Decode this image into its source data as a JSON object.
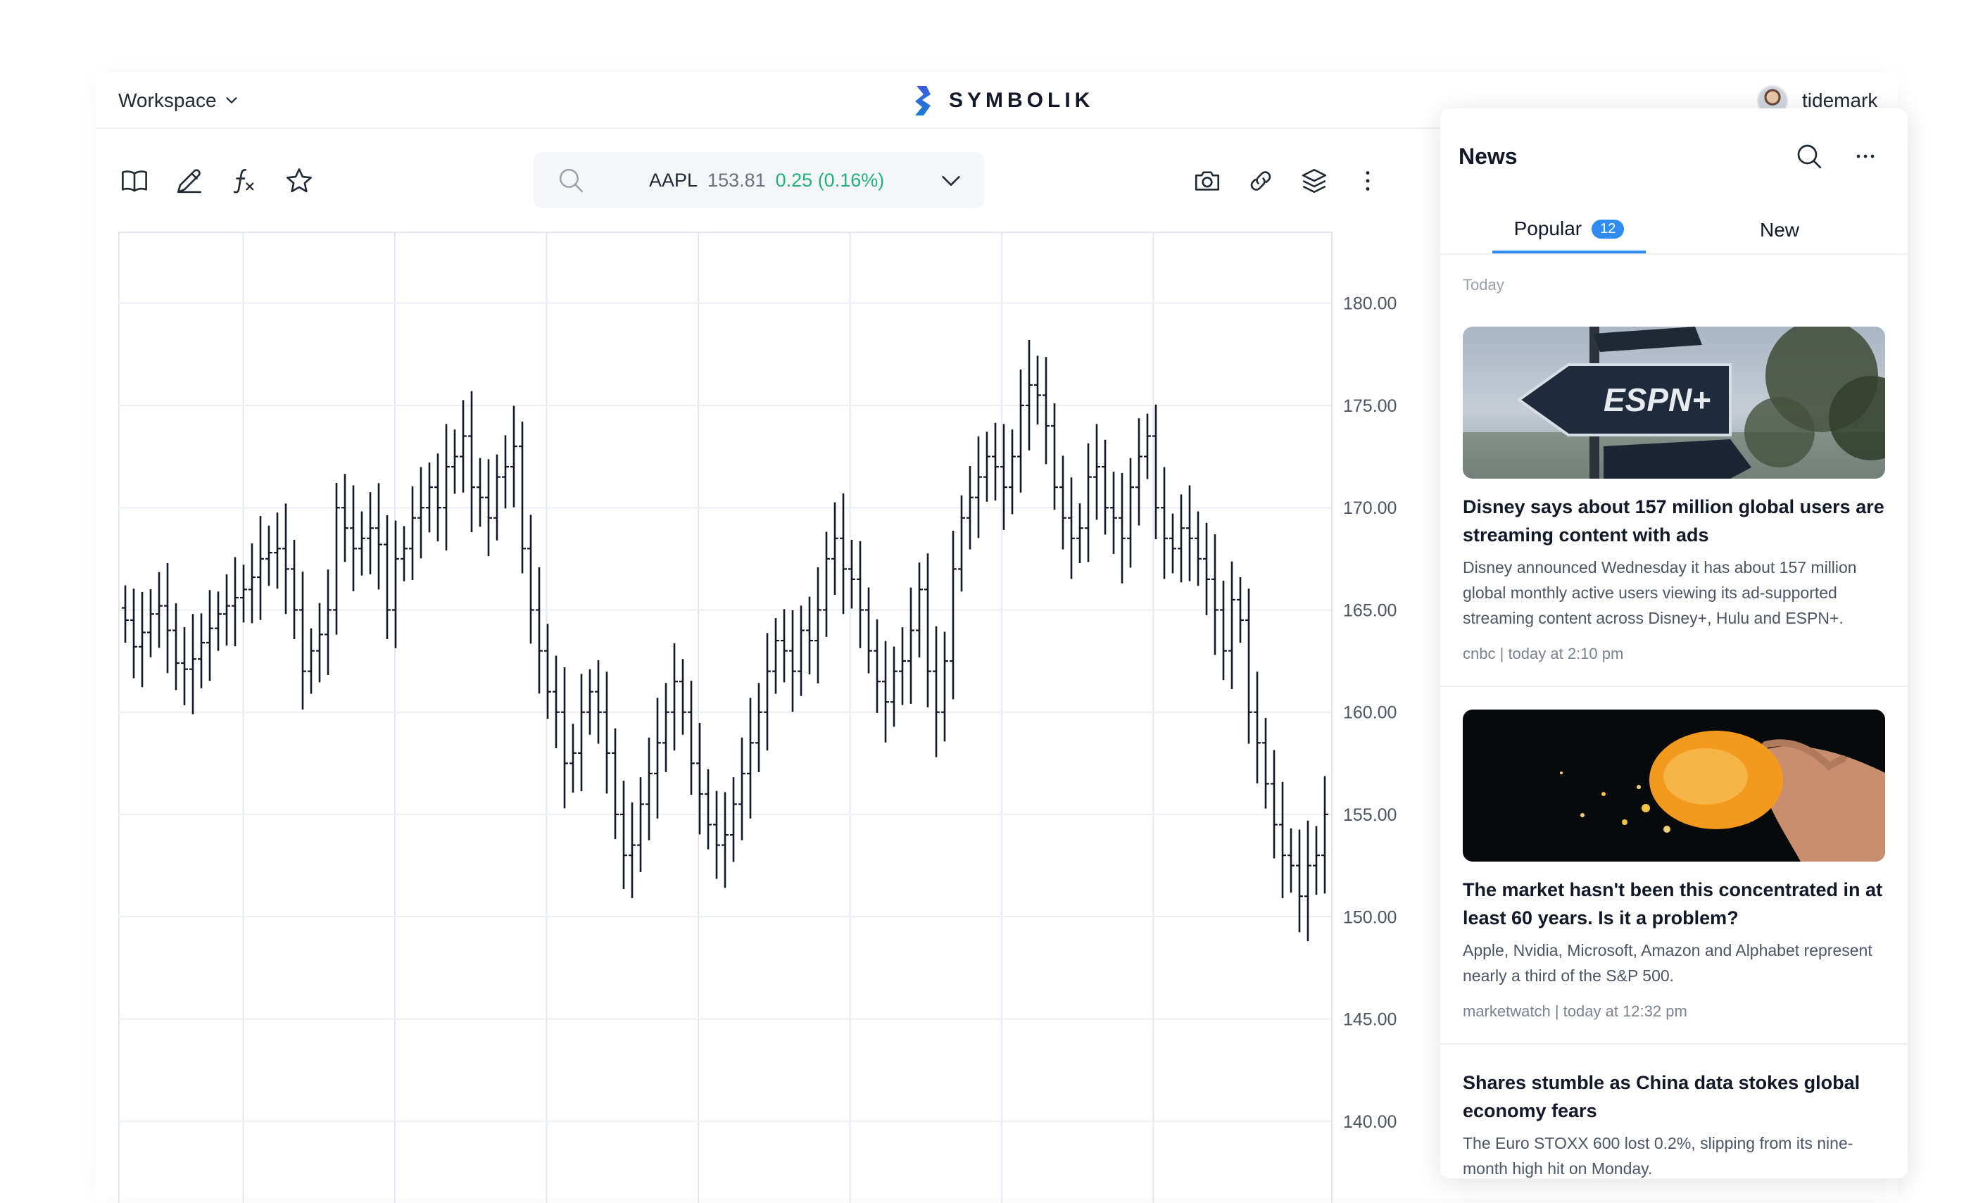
{
  "topbar": {
    "workspace_label": "Workspace",
    "brand_name": "SYMBOLIK",
    "username": "tidemark"
  },
  "ticker": {
    "symbol": "AAPL",
    "price": "153.81",
    "change": "0.25 (0.16%)",
    "change_color": "#22b07d"
  },
  "toolbar": {
    "left_icons": [
      "book-icon",
      "pencil-icon",
      "function-icon",
      "star-icon"
    ],
    "right_icons": [
      "camera-icon",
      "link-icon",
      "layers-icon",
      "more-vertical-icon"
    ]
  },
  "news": {
    "title": "News",
    "tabs": [
      {
        "label": "Popular",
        "count": "12",
        "active": true
      },
      {
        "label": "New",
        "active": false
      }
    ],
    "section_label": "Today",
    "articles": [
      {
        "headline": "Disney says about 157 million global users are streaming content with ads",
        "summary": "Disney announced Wednesday it has about 157 million global monthly active users viewing its ad-supported streaming content across Disney+, Hulu and ESPN+.",
        "source": "cnbc",
        "time": "today at 2:10 pm",
        "image_text": "ESPN+"
      },
      {
        "headline": "The market hasn't been this concentrated in at least 60 years. Is it a problem?",
        "summary": "Apple, Nvidia, Microsoft, Amazon and Alphabet represent nearly a third of the S&P 500.",
        "source": "marketwatch",
        "time": "today at 12:32 pm"
      },
      {
        "headline": "Shares stumble as China data stokes global economy fears",
        "summary": "The Euro STOXX 600 lost 0.2%, slipping from its nine-month high hit on Monday."
      }
    ]
  },
  "chart_data": {
    "type": "ohlc",
    "title": "",
    "xlabel": "",
    "ylabel": "",
    "ylim": [
      136.0,
      183.5
    ],
    "yticks": [
      "180.00",
      "175.00",
      "170.00",
      "165.00",
      "160.00",
      "155.00",
      "150.00",
      "145.00",
      "140.00"
    ],
    "grid": true,
    "closes": [
      164.5,
      163.2,
      163.9,
      164.8,
      165.2,
      164.0,
      162.4,
      162.1,
      162.6,
      163.4,
      164.1,
      164.8,
      165.2,
      165.6,
      166.0,
      166.6,
      167.5,
      167.8,
      168.0,
      167.0,
      165.0,
      162.0,
      163.0,
      163.8,
      165.0,
      170.0,
      169.0,
      168.0,
      168.5,
      169.0,
      168.2,
      165.0,
      167.5,
      168.0,
      169.5,
      170.0,
      171.0,
      170.0,
      172.0,
      172.5,
      173.5,
      171.0,
      170.5,
      169.5,
      171.5,
      172.0,
      173.0,
      168.0,
      165.0,
      163.0,
      161.0,
      160.0,
      157.5,
      158.0,
      160.0,
      161.0,
      160.0,
      158.0,
      155.0,
      153.0,
      153.5,
      155.5,
      157.0,
      158.5,
      160.0,
      161.5,
      160.0,
      157.5,
      156.0,
      154.5,
      153.5,
      154.0,
      155.5,
      157.0,
      158.5,
      160.0,
      162.0,
      163.5,
      163.0,
      162.0,
      164.0,
      163.5,
      165.0,
      167.5,
      168.5,
      167.0,
      166.5,
      165.0,
      163.0,
      161.5,
      160.5,
      162.0,
      162.5,
      164.0,
      166.0,
      162.0,
      160.0,
      162.5,
      167.0,
      169.5,
      170.5,
      171.5,
      172.5,
      172.0,
      171.0,
      172.5,
      175.0,
      176.0,
      175.5,
      174.0,
      171.0,
      169.5,
      168.5,
      169.0,
      171.5,
      172.0,
      170.0,
      169.5,
      168.5,
      171.0,
      172.5,
      173.5,
      170.0,
      168.5,
      168.0,
      169.0,
      168.5,
      167.5,
      166.5,
      165.0,
      163.0,
      165.5,
      164.5,
      160.0,
      158.5,
      156.5,
      154.5,
      153.0,
      152.5,
      151.0,
      152.5,
      153.0,
      155.0
    ]
  }
}
